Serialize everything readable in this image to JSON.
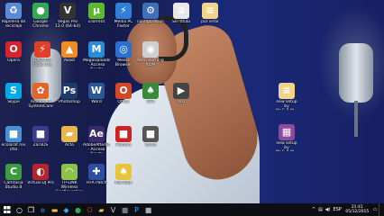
{
  "desktop": {
    "icons": [
      {
        "label": "Papelera de\nreciclaje",
        "icon": "recycle-bin-icon",
        "color": "#5b8bd6"
      },
      {
        "label": "Google Chrome",
        "icon": "chrome-icon",
        "color": "#34a853"
      },
      {
        "label": "Vegas Pro 13.0 (64-bit)",
        "icon": "vegas-icon",
        "color": "#333333"
      },
      {
        "label": "uTorrent",
        "icon": "utorrent-icon",
        "color": "#5cb82e"
      },
      {
        "label": "Media PC Faster",
        "icon": "bolt-icon",
        "color": "#2f7fd8"
      },
      {
        "label": "configuration...",
        "icon": "settings-icon",
        "color": "#3d6fb5"
      },
      {
        "label": "Sin título",
        "icon": "document-icon",
        "color": "#e8e8e8"
      },
      {
        "label": "por error",
        "icon": "document-icon",
        "color": "#f1d58a"
      },
      {
        "label": "Opera",
        "icon": "opera-icon",
        "color": "#d6242c"
      },
      {
        "label": "DAEMON Tools Lite",
        "icon": "daemon-tools-icon",
        "color": "#e0402a"
      },
      {
        "label": "Avast",
        "icon": "shield-icon",
        "color": "#f08a24"
      },
      {
        "label": "MegaUploader - Acceso directo",
        "icon": "mega-icon",
        "color": "#2a8bd6"
      },
      {
        "label": "Media Browser",
        "icon": "browser-icon",
        "color": "#2b6fd0"
      },
      {
        "label": "Nero Burning ROM",
        "icon": "disc-icon",
        "color": "#cfcfcf"
      },
      {
        "label": "Skype",
        "icon": "skype-icon",
        "color": "#00a9e8"
      },
      {
        "label": "Advanced SystemCare",
        "icon": "gear-icon",
        "color": "#e2662a"
      },
      {
        "label": "Photoshop",
        "icon": "photoshop-icon",
        "color": "#1e3b6e"
      },
      {
        "label": "Word",
        "icon": "word-icon",
        "color": "#2b5797"
      },
      {
        "label": "Office",
        "icon": "office-icon",
        "color": "#d24726"
      },
      {
        "label": "GTA",
        "icon": "game-icon",
        "color": "#3a8a3a"
      },
      {
        "label": "VID",
        "icon": "video-icon",
        "color": "#444444"
      },
      {
        "label": "ecolarat rev ctto",
        "icon": "app-icon",
        "color": "#4a90d9"
      },
      {
        "label": "ZaraOS",
        "icon": "app-icon",
        "color": "#3c3c8a"
      },
      {
        "label": "Acto",
        "icon": "folder-icon",
        "color": "#e8b64c"
      },
      {
        "label": "AdobeAfterEffe... - Acceso directo",
        "icon": "after-effects-icon",
        "color": "#3b2a6b"
      },
      {
        "label": "Filmora",
        "icon": "app-icon",
        "color": "#cc2222"
      },
      {
        "label": "Icono",
        "icon": "app-icon",
        "color": "#555555"
      },
      {
        "label": "Camtasia Studio 8",
        "icon": "camtasia-icon",
        "color": "#3f9b3f"
      },
      {
        "label": "Virtual DJ Pro",
        "icon": "dj-icon",
        "color": "#b8242c"
      },
      {
        "label": "TP-LINK Wireless Configuration ...",
        "icon": "wifi-icon",
        "color": "#8bc34a"
      },
      {
        "label": "FIFA Patch",
        "icon": "patch-icon",
        "color": "#2d4fa3"
      },
      {
        "label": "Pac-Man",
        "icon": "game-icon",
        "color": "#e8c43a"
      },
      {
        "label": "new setup by\nMr.G.B.M...",
        "icon": "document-icon",
        "color": "#f2d38c"
      },
      {
        "label": "new setup by\nMr.G.B.M...",
        "icon": "archive-icon",
        "color": "#8b4a9c"
      }
    ]
  },
  "taskbar": {
    "start_label": "Start",
    "search_glyph": "○",
    "task_view_glyph": "❐",
    "pinned": [
      {
        "name": "edge-icon",
        "glyph": "e",
        "color": "#3a8ee6"
      },
      {
        "name": "file-explorer-icon",
        "glyph": "▬",
        "color": "#f2c14e"
      },
      {
        "name": "store-icon",
        "glyph": "◆",
        "color": "#4a9ee8"
      },
      {
        "name": "chrome-icon",
        "glyph": "●",
        "color": "#34a853"
      },
      {
        "name": "opera-icon",
        "glyph": "O",
        "color": "#d6242c"
      },
      {
        "name": "folder-icon",
        "glyph": "▰",
        "color": "#f2c14e"
      },
      {
        "name": "vegas-icon",
        "glyph": "V",
        "color": "#cccccc"
      },
      {
        "name": "app-icon",
        "glyph": "■",
        "color": "#777777"
      },
      {
        "name": "photoshop-icon",
        "glyph": "P",
        "color": "#4aa3f0"
      },
      {
        "name": "app-icon",
        "glyph": "■",
        "color": "#aaaaaa"
      }
    ],
    "tray": {
      "language": "ESP",
      "time": "21:41",
      "date": "05/12/2015"
    }
  }
}
